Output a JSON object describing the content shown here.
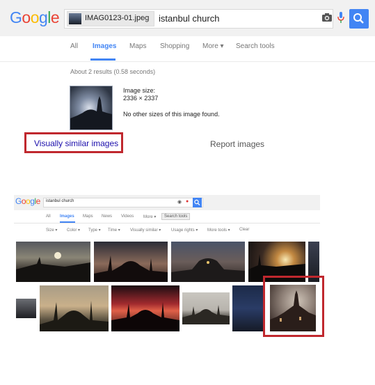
{
  "panel1": {
    "logo": {
      "G": "G",
      "o1": "o",
      "o2": "o",
      "g": "g",
      "l": "l",
      "e": "e"
    },
    "search": {
      "chip_filename": "IMAG0123-01.jpeg",
      "chip_close": "×",
      "query": "istanbul church",
      "camera_icon": "camera-icon",
      "mic_icon": "mic-icon",
      "search_icon": "search-icon"
    },
    "tabs": [
      "All",
      "Images",
      "Maps",
      "Shopping",
      "More ▾",
      "Search tools"
    ],
    "active_tab": "Images",
    "stats": "About 2 results (0.58 seconds)",
    "image_info": {
      "size_label": "Image size:",
      "size_value": "2336 × 2337",
      "no_sizes": "No other sizes of this image found."
    },
    "links": {
      "visually_similar": "Visually similar images",
      "report": "Report images"
    },
    "colors": {
      "highlight": "#c0282e",
      "accent": "#4285f4",
      "link": "#1a0dab"
    }
  },
  "panel2": {
    "search": {
      "query": "istanbul church"
    },
    "tabs": [
      "All",
      "Images",
      "Maps",
      "News",
      "Videos",
      "More ▾",
      "Search tools"
    ],
    "active_tab": "Images",
    "tools": [
      "Size ▾",
      "Color ▾",
      "Type ▾",
      "Time ▾",
      "Visually similar ▾",
      "Usage rights ▾",
      "More tools ▾",
      "Clear"
    ]
  }
}
